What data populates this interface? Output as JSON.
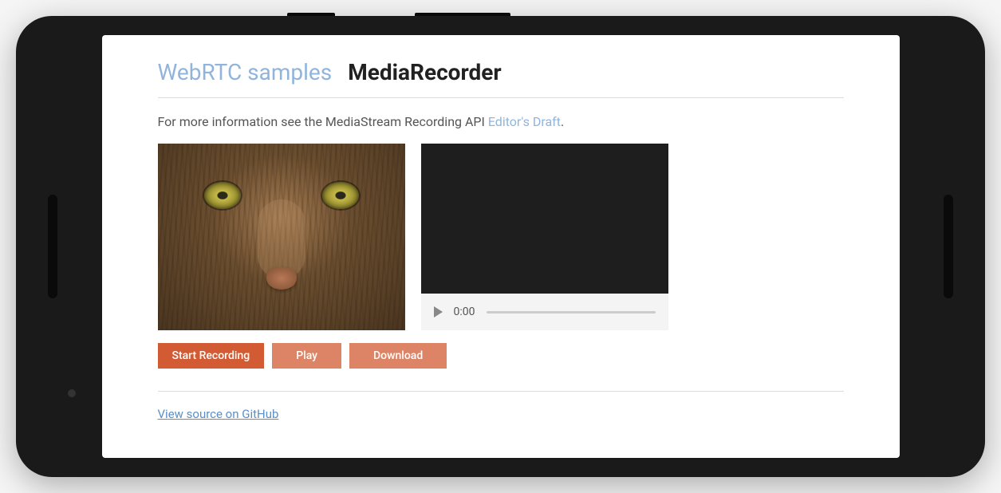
{
  "header": {
    "link_text": "WebRTC samples",
    "title": "MediaRecorder"
  },
  "description": {
    "prefix": "For more information see the MediaStream Recording API ",
    "link_text": "Editor's Draft",
    "suffix": "."
  },
  "video_player": {
    "time": "0:00"
  },
  "buttons": {
    "start_recording": "Start Recording",
    "play": "Play",
    "download": "Download"
  },
  "footer": {
    "github_link": "View source on GitHub"
  }
}
